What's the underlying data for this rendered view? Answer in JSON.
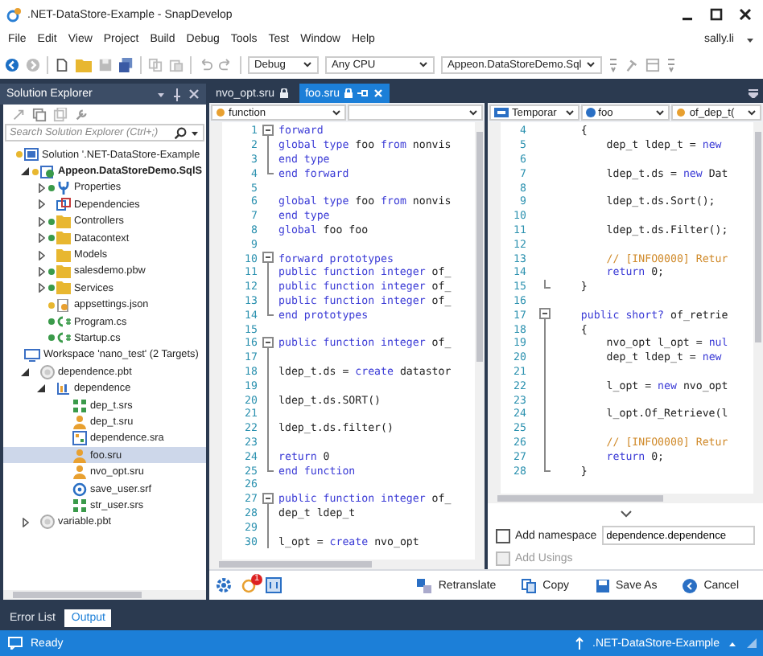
{
  "window": {
    "title": ".NET-DataStore-Example - SnapDevelop"
  },
  "menu": [
    "File",
    "Edit",
    "View",
    "Project",
    "Build",
    "Debug",
    "Tools",
    "Test",
    "Window",
    "Help"
  ],
  "user": "sally.li",
  "toolbar": {
    "configuration": "Debug",
    "platform": "Any CPU",
    "startup_project": "Appeon.DataStoreDemo.Sql"
  },
  "solution_explorer": {
    "title": "Solution Explorer",
    "search": {
      "placeholder": "Search Solution Explorer (Ctrl+;)"
    },
    "tree": [
      {
        "label": "Solution '.NET-DataStore-Example",
        "kind": "solution",
        "color": "#e8b730",
        "selected": false,
        "children": [
          {
            "label": "Appeon.DataStoreDemo.SqlS",
            "kind": "project",
            "color": "#e8b730",
            "expanded": true,
            "selected": false,
            "children": [
              {
                "label": "Properties",
                "kind": "wrench",
                "color": "#3a9a4a",
                "expanded": false,
                "selected": false
              },
              {
                "label": "Dependencies",
                "kind": "deps",
                "expanded": false,
                "selected": false
              },
              {
                "label": "Controllers",
                "kind": "folder",
                "color": "#3a9a4a",
                "expanded": false,
                "selected": false
              },
              {
                "label": "Datacontext",
                "kind": "folder",
                "color": "#3a9a4a",
                "expanded": false,
                "selected": false
              },
              {
                "label": "Models",
                "kind": "folder",
                "expanded": false,
                "selected": false
              },
              {
                "label": "salesdemo.pbw",
                "kind": "folder",
                "color": "#3a9a4a",
                "expanded": false,
                "selected": false
              },
              {
                "label": "Services",
                "kind": "folder",
                "color": "#3a9a4a",
                "expanded": false,
                "selected": false
              },
              {
                "label": "appsettings.json",
                "kind": "json",
                "color": "#e8b730",
                "selected": false
              },
              {
                "label": "Program.cs",
                "kind": "cs",
                "color": "#3a9a4a",
                "selected": false
              },
              {
                "label": "Startup.cs",
                "kind": "cs",
                "color": "#3a9a4a",
                "selected": false
              }
            ]
          }
        ]
      },
      {
        "label": "Workspace 'nano_test' (2 Targets)",
        "kind": "workspace",
        "selected": false,
        "children": [
          {
            "label": "dependence.pbt",
            "kind": "target",
            "expanded": true,
            "selected": false,
            "children": [
              {
                "label": "dependence",
                "kind": "library",
                "expanded": true,
                "selected": false,
                "children": [
                  {
                    "label": "dep_t.srs",
                    "kind": "structure",
                    "selected": false
                  },
                  {
                    "label": "dep_t.sru",
                    "kind": "userobject",
                    "selected": false
                  },
                  {
                    "label": "dependence.sra",
                    "kind": "application",
                    "selected": false
                  },
                  {
                    "label": "foo.sru",
                    "kind": "userobject",
                    "selected": true
                  },
                  {
                    "label": "nvo_opt.sru",
                    "kind": "userobject",
                    "selected": false
                  },
                  {
                    "label": "save_user.srf",
                    "kind": "function",
                    "selected": false
                  },
                  {
                    "label": "str_user.srs",
                    "kind": "structure",
                    "selected": false
                  }
                ]
              }
            ]
          },
          {
            "label": "variable.pbt",
            "kind": "target",
            "expanded": false,
            "selected": false
          }
        ]
      }
    ]
  },
  "editor_tabs": [
    {
      "label": "nvo_opt.sru",
      "selected": false
    },
    {
      "label": "foo.sru",
      "selected": true
    }
  ],
  "source_editor": {
    "dropdowns": [
      {
        "label": "function",
        "kind": "member"
      }
    ],
    "lines": [
      {
        "n": "1",
        "kind": "open",
        "tokens": [
          {
            "text": "forward",
            "kind": "kw"
          }
        ]
      },
      {
        "n": "2",
        "tokens": [
          {
            "text": "global type",
            "kind": "kw"
          },
          {
            "text": " foo ",
            "kind": "tx"
          },
          {
            "text": "from",
            "kind": "kw"
          },
          {
            "text": " nonvis",
            "kind": "tx"
          }
        ]
      },
      {
        "n": "3",
        "tokens": [
          {
            "text": "end type",
            "kind": "kw"
          }
        ]
      },
      {
        "n": "4",
        "kind": "close",
        "tokens": [
          {
            "text": "end forward",
            "kind": "kw"
          }
        ]
      },
      {
        "n": "5"
      },
      {
        "n": "6",
        "tokens": [
          {
            "text": "global type",
            "kind": "kw"
          },
          {
            "text": " foo ",
            "kind": "tx"
          },
          {
            "text": "from",
            "kind": "kw"
          },
          {
            "text": " nonvis",
            "kind": "tx"
          }
        ]
      },
      {
        "n": "7",
        "tokens": [
          {
            "text": "end type",
            "kind": "kw"
          }
        ]
      },
      {
        "n": "8",
        "tokens": [
          {
            "text": "global",
            "kind": "kw"
          },
          {
            "text": " foo foo",
            "kind": "tx"
          }
        ]
      },
      {
        "n": "9"
      },
      {
        "n": "10",
        "kind": "open",
        "tokens": [
          {
            "text": "forward prototypes",
            "kind": "kw"
          }
        ]
      },
      {
        "n": "11",
        "tokens": [
          {
            "text": "public function integer",
            "kind": "kw"
          },
          {
            "text": " of_",
            "kind": "tx"
          }
        ]
      },
      {
        "n": "12",
        "tokens": [
          {
            "text": "public function integer",
            "kind": "kw"
          },
          {
            "text": " of_",
            "kind": "tx"
          }
        ]
      },
      {
        "n": "13",
        "tokens": [
          {
            "text": "public function integer",
            "kind": "kw"
          },
          {
            "text": " of_",
            "kind": "tx"
          }
        ]
      },
      {
        "n": "14",
        "kind": "close",
        "tokens": [
          {
            "text": "end prototypes",
            "kind": "kw"
          }
        ]
      },
      {
        "n": "15"
      },
      {
        "n": "16",
        "kind": "open",
        "tokens": [
          {
            "text": "public function integer",
            "kind": "kw"
          },
          {
            "text": " of_",
            "kind": "tx"
          }
        ]
      },
      {
        "n": "17"
      },
      {
        "n": "18",
        "tokens": [
          {
            "text": "ldep_t.ds = ",
            "kind": "tx"
          },
          {
            "text": "create",
            "kind": "kw"
          },
          {
            "text": " datastor",
            "kind": "tx"
          }
        ]
      },
      {
        "n": "19"
      },
      {
        "n": "20",
        "tokens": [
          {
            "text": "ldep_t.ds.SORT()",
            "kind": "tx"
          }
        ]
      },
      {
        "n": "21"
      },
      {
        "n": "22",
        "tokens": [
          {
            "text": "ldep_t.ds.filter()",
            "kind": "tx"
          }
        ]
      },
      {
        "n": "23"
      },
      {
        "n": "24",
        "tokens": [
          {
            "text": "return",
            "kind": "kw"
          },
          {
            "text": " 0",
            "kind": "tx"
          }
        ]
      },
      {
        "n": "25",
        "kind": "close",
        "tokens": [
          {
            "text": "end function",
            "kind": "kw"
          }
        ]
      },
      {
        "n": "26"
      },
      {
        "n": "27",
        "kind": "open",
        "tokens": [
          {
            "text": "public function integer",
            "kind": "kw"
          },
          {
            "text": " of_",
            "kind": "tx"
          }
        ]
      },
      {
        "n": "28",
        "tokens": [
          {
            "text": "dep_t ldep_t",
            "kind": "tx"
          }
        ]
      },
      {
        "n": "29"
      },
      {
        "n": "30",
        "tokens": [
          {
            "text": "l_opt = ",
            "kind": "tx"
          },
          {
            "text": "create",
            "kind": "kw"
          },
          {
            "text": " nvo_opt",
            "kind": "tx"
          }
        ]
      }
    ]
  },
  "translated_editor": {
    "dropdowns": [
      {
        "label": "Temporar",
        "kind": "namespace"
      },
      {
        "label": "foo",
        "kind": "class"
      },
      {
        "label": "of_dep_t(",
        "kind": "member"
      }
    ],
    "lines": [
      {
        "n": "4",
        "tokens": [
          {
            "text": "   {",
            "kind": "tx"
          }
        ]
      },
      {
        "n": "5",
        "tokens": [
          {
            "text": "       dep_t ldep_t = ",
            "kind": "tx"
          },
          {
            "text": "new",
            "kind": "kw"
          }
        ]
      },
      {
        "n": "6"
      },
      {
        "n": "7",
        "tokens": [
          {
            "text": "       ldep_t.ds = ",
            "kind": "tx"
          },
          {
            "text": "new",
            "kind": "kw"
          },
          {
            "text": " Dat",
            "kind": "tx"
          }
        ]
      },
      {
        "n": "8"
      },
      {
        "n": "9",
        "tokens": [
          {
            "text": "       ldep_t.ds.Sort();",
            "kind": "tx"
          }
        ]
      },
      {
        "n": "10"
      },
      {
        "n": "11",
        "tokens": [
          {
            "text": "       ldep_t.ds.Filter();",
            "kind": "tx"
          }
        ]
      },
      {
        "n": "12"
      },
      {
        "n": "13",
        "tokens": [
          {
            "text": "       // [INFO0000] Retur",
            "kind": "cm"
          }
        ]
      },
      {
        "n": "14",
        "tokens": [
          {
            "text": "       return",
            "kind": "kw"
          },
          {
            "text": " 0;",
            "kind": "tx"
          }
        ]
      },
      {
        "n": "15",
        "kind": "close",
        "tokens": [
          {
            "text": "   }",
            "kind": "tx"
          }
        ]
      },
      {
        "n": "16"
      },
      {
        "n": "17",
        "kind": "open",
        "tokens": [
          {
            "text": "   public short?",
            "kind": "kw"
          },
          {
            "text": " of_retrie",
            "kind": "tx"
          }
        ]
      },
      {
        "n": "18",
        "tokens": [
          {
            "text": "   {",
            "kind": "tx"
          }
        ]
      },
      {
        "n": "19",
        "tokens": [
          {
            "text": "       nvo_opt l_opt = ",
            "kind": "tx"
          },
          {
            "text": "nul",
            "kind": "kw"
          }
        ]
      },
      {
        "n": "20",
        "tokens": [
          {
            "text": "       dep_t ldep_t = ",
            "kind": "tx"
          },
          {
            "text": "new",
            "kind": "kw"
          }
        ]
      },
      {
        "n": "21"
      },
      {
        "n": "22",
        "tokens": [
          {
            "text": "       l_opt = ",
            "kind": "tx"
          },
          {
            "text": "new",
            "kind": "kw"
          },
          {
            "text": " nvo_opt",
            "kind": "tx"
          }
        ]
      },
      {
        "n": "23"
      },
      {
        "n": "24",
        "tokens": [
          {
            "text": "       l_opt.Of_Retrieve(l",
            "kind": "tx"
          }
        ]
      },
      {
        "n": "25"
      },
      {
        "n": "26",
        "tokens": [
          {
            "text": "       // [INFO0000] Retur",
            "kind": "cm"
          }
        ]
      },
      {
        "n": "27",
        "tokens": [
          {
            "text": "       return",
            "kind": "kw"
          },
          {
            "text": " 0;",
            "kind": "tx"
          }
        ]
      },
      {
        "n": "28",
        "kind": "close",
        "tokens": [
          {
            "text": "   }",
            "kind": "tx"
          }
        ]
      }
    ],
    "add_namespace": {
      "label": "Add namespace",
      "checked": false,
      "value": "dependence.dependence"
    },
    "add_usings": {
      "label": "Add Usings",
      "checked": false,
      "disabled": true
    }
  },
  "notification_badge": "1",
  "actions": [
    {
      "label": "Retranslate",
      "kind": "translate"
    },
    {
      "label": "Copy",
      "kind": "copy"
    },
    {
      "label": "Save As",
      "kind": "save"
    },
    {
      "label": "Cancel",
      "kind": "cancel"
    }
  ],
  "bottom_tabs": [
    {
      "label": "Error List",
      "selected": false
    },
    {
      "label": "Output",
      "selected": true
    }
  ],
  "status_bar": {
    "text": "Ready",
    "project": ".NET-DataStore-Example"
  }
}
